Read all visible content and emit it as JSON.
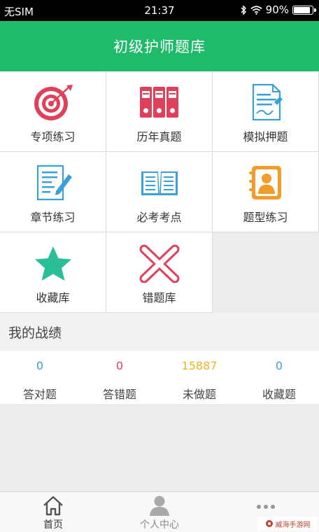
{
  "status_bar": {
    "carrier": "无SIM",
    "time": "21:37",
    "battery": "90%",
    "battery_level": 0.9
  },
  "header": {
    "title": "初级护师题库"
  },
  "grid": [
    {
      "label": "专项练习",
      "icon": "target-icon"
    },
    {
      "label": "历年真题",
      "icon": "binders-icon"
    },
    {
      "label": "模拟押题",
      "icon": "document-pen-icon"
    },
    {
      "label": "章节练习",
      "icon": "notepad-pen-icon"
    },
    {
      "label": "必考考点",
      "icon": "open-book-icon"
    },
    {
      "label": "题型练习",
      "icon": "contact-book-icon"
    },
    {
      "label": "收藏库",
      "icon": "star-icon"
    },
    {
      "label": "错题库",
      "icon": "x-mark-icon"
    }
  ],
  "stats_section": {
    "title": "我的战绩",
    "items": [
      {
        "value": "0",
        "label": "答对题",
        "color": "#3aa0d8"
      },
      {
        "value": "0",
        "label": "答错题",
        "color": "#e0405a"
      },
      {
        "value": "15887",
        "label": "未做题",
        "color": "#f0b323"
      },
      {
        "value": "0",
        "label": "收藏题",
        "color": "#3aa0d8"
      }
    ]
  },
  "tabbar": {
    "tabs": [
      {
        "label": "首页",
        "icon": "home-icon",
        "active": true
      },
      {
        "label": "个人中心",
        "icon": "person-icon",
        "active": false
      },
      {
        "label": "",
        "icon": "more-dots-icon",
        "active": false
      }
    ]
  },
  "watermark": {
    "text": "威海手游网"
  },
  "colors": {
    "brand_green": "#1fba6a",
    "red": "#e0405a",
    "teal": "#2bbf99",
    "blue": "#3aa0d8",
    "orange": "#f39c2a"
  }
}
